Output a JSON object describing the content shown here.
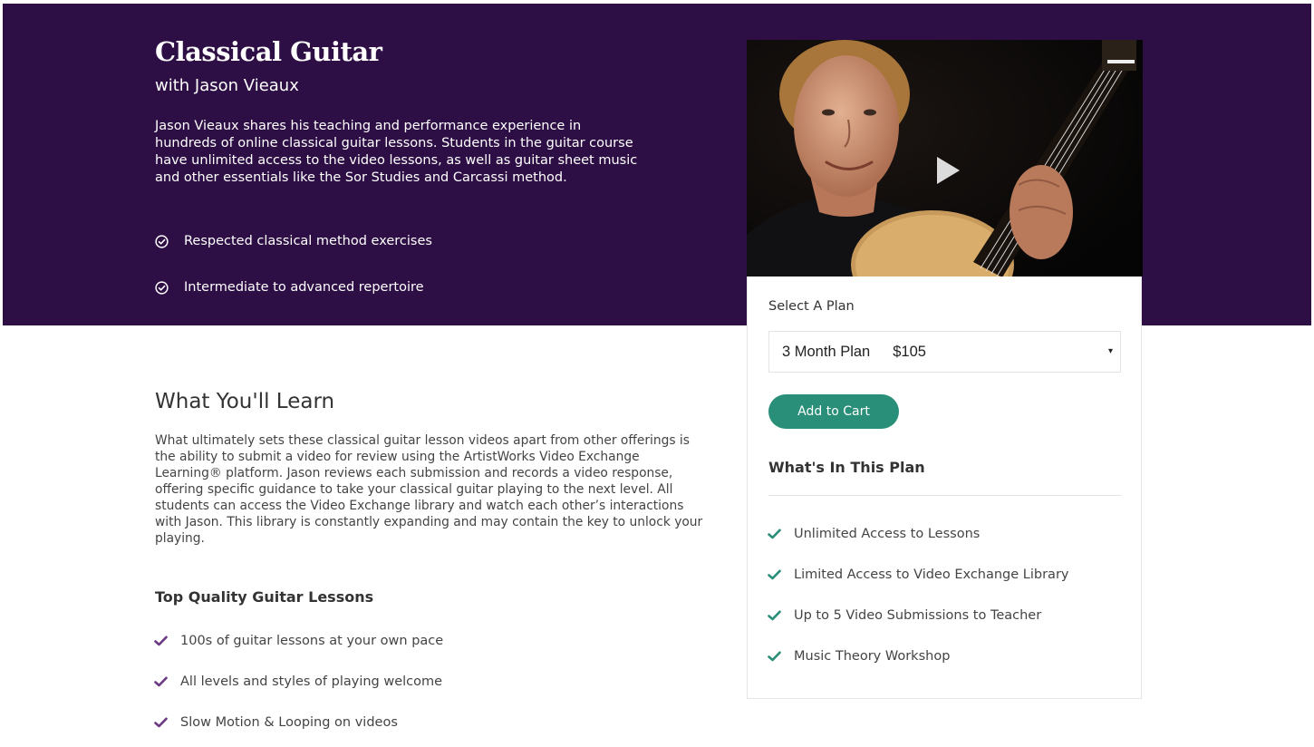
{
  "hero": {
    "title": "Classical Guitar",
    "subtitle": "with Jason Vieaux",
    "description": "Jason Vieaux shares his teaching and performance experience in hundreds of online classical guitar lessons. Students in the guitar course have unlimited access to the video lessons, as well as guitar sheet music and other essentials like the Sor Studies and Carcassi method.",
    "features": [
      {
        "label": "Respected classical method exercises",
        "icon": "check-circle-icon"
      },
      {
        "label": "Intermediate to advanced repertoire",
        "icon": "check-circle-icon"
      }
    ],
    "background_color": "#2e0f45"
  },
  "video": {
    "play_icon": "play-icon"
  },
  "plan": {
    "select_label": "Select A Plan",
    "selected_plan": "3 Month Plan",
    "selected_price": "$105",
    "caret": "▾",
    "add_to_cart": "Add to Cart",
    "button_color": "#2a8f78",
    "heading": "What's In This Plan",
    "items": [
      {
        "label": "Unlimited Access to Lessons",
        "icon": "check-icon"
      },
      {
        "label": "Limited Access to Video Exchange Library",
        "icon": "check-icon"
      },
      {
        "label": "Up to 5 Video Submissions to Teacher",
        "icon": "check-icon"
      },
      {
        "label": "Music Theory Workshop",
        "icon": "check-icon"
      }
    ],
    "check_color": "#2a8f78"
  },
  "learn": {
    "title": "What You'll Learn",
    "body": "What ultimately sets these classical guitar lesson videos apart from other offerings is the ability to submit a video for review using the ArtistWorks Video Exchange Learning® platform. Jason reviews each submission and records a video response, offering specific guidance to take your classical guitar playing to the next level. All students can access the Video Exchange library and watch each other’s interactions with Jason. This library is constantly expanding and may contain the key to unlock your playing.",
    "lessons_heading": "Top Quality Guitar Lessons",
    "lessons": [
      {
        "label": "100s of guitar lessons at your own pace",
        "icon": "check-icon"
      },
      {
        "label": "All levels and styles of playing welcome",
        "icon": "check-icon"
      },
      {
        "label": "Slow Motion & Looping on videos",
        "icon": "check-icon"
      }
    ],
    "check_color": "#6b3a83"
  }
}
